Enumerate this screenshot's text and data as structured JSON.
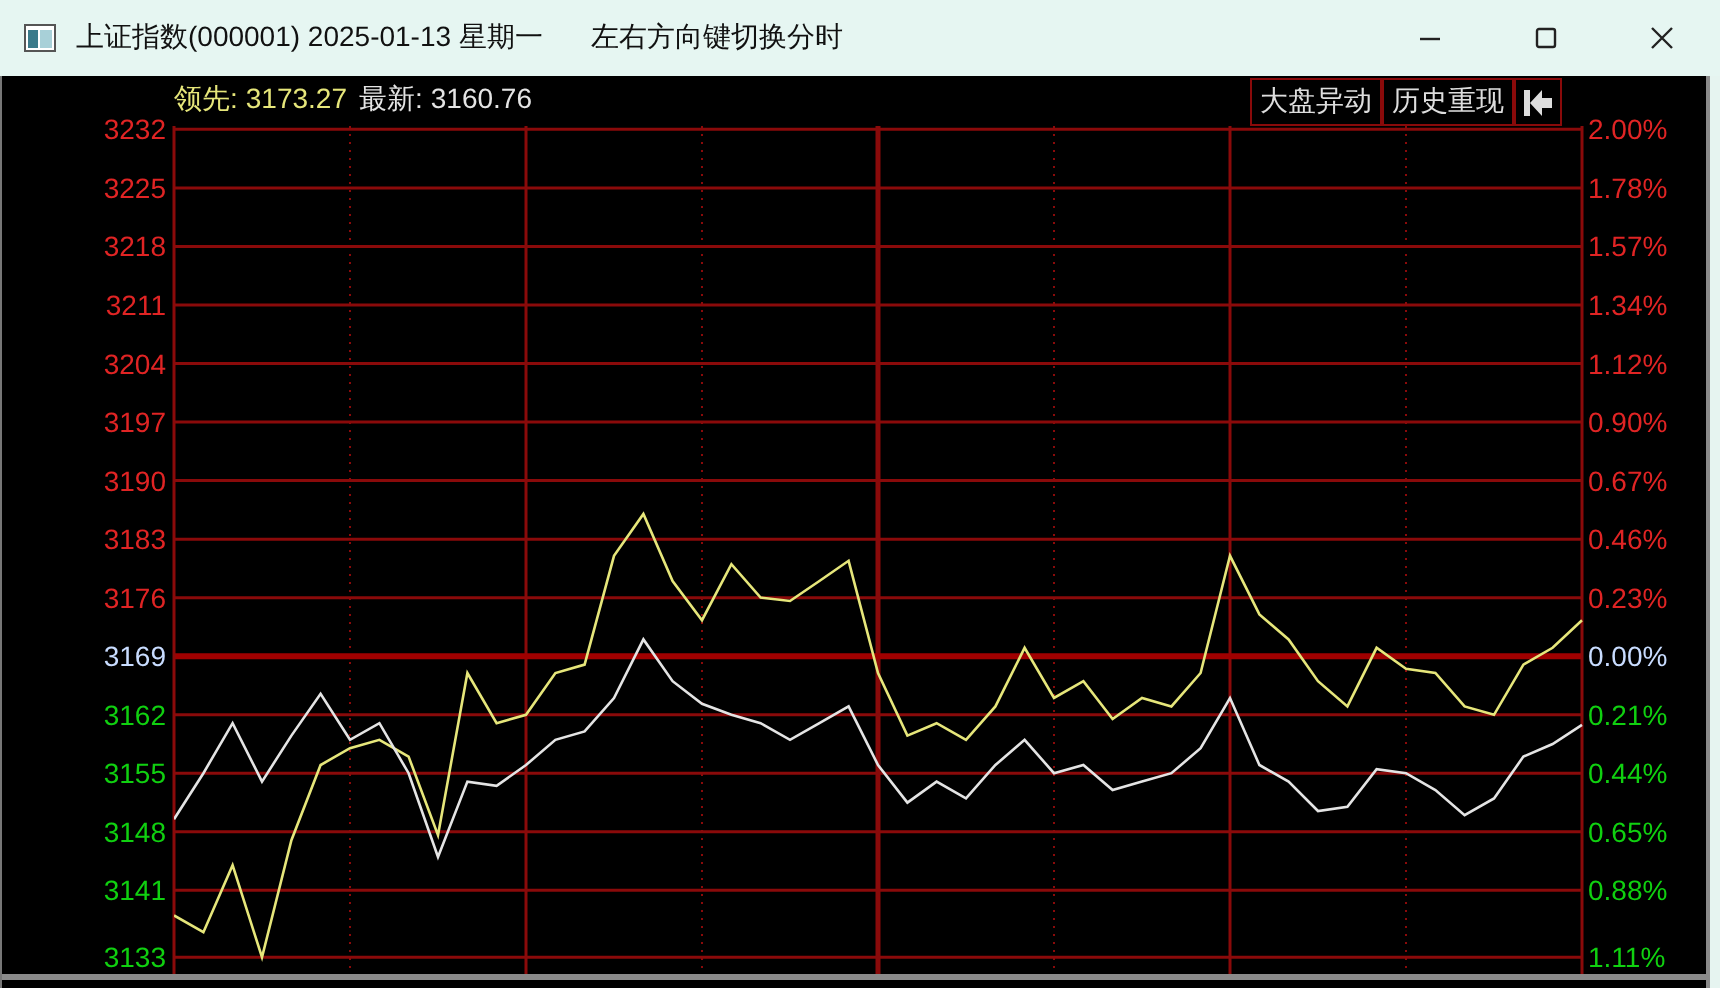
{
  "window": {
    "title": "上证指数(000001) 2025-01-13 星期一",
    "hint": "左右方向键切换分时"
  },
  "legend": [
    {
      "value": "3173.27"
    },
    {
      "value": "3160.76"
    }
  ],
  "toolbar": [
    "大盘异动",
    "历史重现"
  ],
  "percent_axis": [
    {
      "label": "2.00%",
      "kind": "up"
    },
    {
      "label": "1.78%",
      "kind": "up"
    },
    {
      "label": "1.57%",
      "kind": "up"
    },
    {
      "label": "1.34%",
      "kind": "up"
    },
    {
      "label": "1.12%",
      "kind": "up"
    },
    {
      "label": "0.90%",
      "kind": "up"
    },
    {
      "label": "0.67%",
      "kind": "up"
    },
    {
      "label": "0.46%",
      "kind": "up"
    },
    {
      "label": "0.23%",
      "kind": "up"
    },
    {
      "label": "0.00%",
      "kind": "flat"
    },
    {
      "label": "0.21%",
      "kind": "down"
    },
    {
      "label": "0.44%",
      "kind": "down"
    },
    {
      "label": "0.65%",
      "kind": "down"
    },
    {
      "label": "0.88%",
      "kind": "down"
    },
    {
      "label": "1.11%",
      "kind": "down"
    }
  ],
  "chart": {
    "chart_data": {
      "type": "line",
      "categories": [
        null,
        null,
        null,
        null,
        null,
        null,
        null,
        null,
        null,
        null,
        null,
        null,
        null,
        null,
        null,
        null,
        null,
        null,
        null,
        null,
        null,
        null,
        null,
        null,
        null,
        null,
        null,
        null,
        null,
        null,
        null,
        null,
        null,
        null,
        null,
        null,
        null,
        null,
        null,
        null,
        null,
        null,
        null,
        null,
        null,
        null,
        null,
        null,
        null
      ],
      "series": [
        {
          "name": "领先:",
          "color": "#e6e67a",
          "values": [
            3138,
            3136,
            3144,
            3133,
            3147,
            3156,
            3158,
            3159,
            3157,
            3147.6,
            3167,
            3161,
            3162,
            3167,
            3168,
            3181,
            3186,
            3178,
            3173.3,
            3180,
            3176,
            3175.6,
            3178,
            3180.4,
            3167,
            3159.5,
            3161,
            3159,
            3163,
            3170,
            3164,
            3166,
            3161.5,
            3164,
            3163,
            3167,
            3181,
            3174,
            3171,
            3166,
            3163,
            3170,
            3167.5,
            3167,
            3163,
            3162,
            3168,
            3170,
            3173.3
          ]
        },
        {
          "name": "最新:",
          "color": "#e4e4e4",
          "values": [
            3149.5,
            3155,
            3161,
            3154,
            3159.5,
            3164.5,
            3159,
            3161,
            3155,
            3145,
            3154,
            3153.5,
            3156,
            3159,
            3160,
            3164,
            3171,
            3166,
            3163.3,
            3162,
            3161,
            3159,
            3161,
            3163,
            3156,
            3151.5,
            3154,
            3152,
            3156,
            3159,
            3155,
            3156,
            3153,
            3154,
            3155,
            3158,
            3164,
            3156,
            3154,
            3150.5,
            3151,
            3155.5,
            3155,
            3153,
            3150,
            3152,
            3157,
            3158.5,
            3160.8
          ]
        }
      ],
      "ylim": [
        3131,
        3232.4
      ],
      "grid": true,
      "ref_lines": [
        {
          "axis": "y",
          "value": 3169
        }
      ],
      "yticks": [
        {
          "value": 3232,
          "label": "3232"
        },
        {
          "value": 3225,
          "label": "3225"
        },
        {
          "value": 3218,
          "label": "3218"
        },
        {
          "value": 3211,
          "label": "3211"
        },
        {
          "value": 3204,
          "label": "3204"
        },
        {
          "value": 3197,
          "label": "3197"
        },
        {
          "value": 3190,
          "label": "3190"
        },
        {
          "value": 3183,
          "label": "3183"
        },
        {
          "value": 3176,
          "label": "3176"
        },
        {
          "value": 3169,
          "label": "3169"
        },
        {
          "value": 3162,
          "label": "3162"
        },
        {
          "value": 3155,
          "label": "3155"
        },
        {
          "value": 3148,
          "label": "3148"
        },
        {
          "value": 3141,
          "label": "3141"
        },
        {
          "value": 3133,
          "label": "3133"
        }
      ]
    }
  }
}
